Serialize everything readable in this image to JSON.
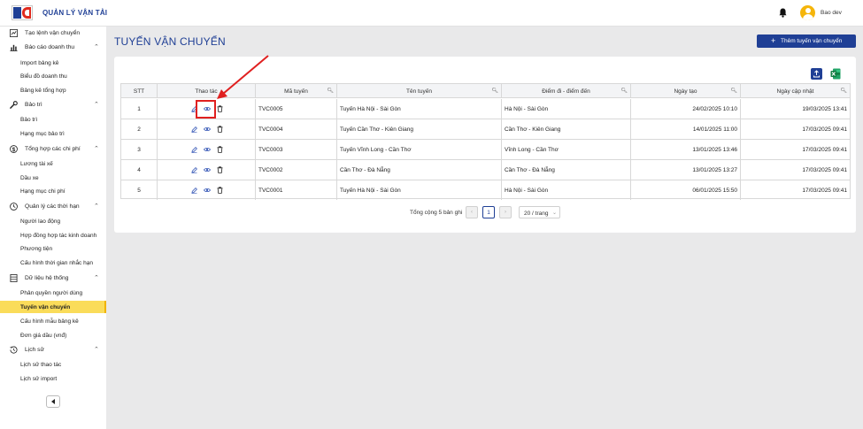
{
  "app": {
    "title": "QUẢN LÝ VẬN TẢI",
    "user": "Bao dev"
  },
  "sidebar": {
    "top_item": "Tạo lệnh vận chuyển",
    "groups": [
      {
        "label": "Báo cáo doanh thu",
        "items": [
          "Import bảng kê",
          "Biểu đồ doanh thu",
          "Bảng kê tổng hợp"
        ]
      },
      {
        "label": "Bảo trì",
        "items": [
          "Bảo trì",
          "Hạng mục bảo trì"
        ]
      },
      {
        "label": "Tổng hợp các chi phí",
        "items": [
          "Lương tài xế",
          "Dầu xe",
          "Hạng mục chi phí"
        ]
      },
      {
        "label": "Quản lý các thời hạn",
        "items": [
          "Người lao động",
          "Hợp đồng hợp tác kinh doanh",
          "Phương tiện",
          "Cấu hình thời gian nhắc hạn"
        ]
      },
      {
        "label": "Dữ liệu hệ thống",
        "items": [
          "Phân quyền người dùng",
          "Tuyến vận chuyển",
          "Cấu hình mẫu bảng kê",
          "Đơn giá dầu (vnđ)"
        ]
      },
      {
        "label": "Lịch sử",
        "items": [
          "Lịch sử thao tác",
          "Lịch sử import"
        ]
      }
    ],
    "active_item": "Tuyến vận chuyển"
  },
  "page": {
    "title": "TUYẾN VẬN CHUYỂN",
    "add_button": "Thêm tuyến vận chuyển"
  },
  "table": {
    "headers": [
      "STT",
      "Thao tác",
      "Mã tuyến",
      "Tên tuyến",
      "Điểm đi - điểm đến",
      "Ngày tạo",
      "Ngày cập nhật"
    ],
    "rows": [
      {
        "stt": "1",
        "code": "TVC0005",
        "name": "Tuyến Hà Nội - Sài Gòn",
        "route": "Hà Nội - Sài Gòn",
        "created": "24/02/2025 10:10",
        "updated": "19/03/2025 13:41"
      },
      {
        "stt": "2",
        "code": "TVC0004",
        "name": "Tuyến Cần Thơ - Kiên Giang",
        "route": "Cần Thơ - Kiên Giang",
        "created": "14/01/2025 11:00",
        "updated": "17/03/2025 09:41"
      },
      {
        "stt": "3",
        "code": "TVC0003",
        "name": "Tuyến Vĩnh Long - Cần Thơ",
        "route": "Vĩnh Long - Cần Thơ",
        "created": "13/01/2025 13:46",
        "updated": "17/03/2025 09:41"
      },
      {
        "stt": "4",
        "code": "TVC0002",
        "name": "Cần Thơ - Đà Nẵng",
        "route": "Cần Thơ - Đà Nẵng",
        "created": "13/01/2025 13:27",
        "updated": "17/03/2025 09:41"
      },
      {
        "stt": "5",
        "code": "TVC0001",
        "name": "Tuyến Hà Nội - Sài Gòn",
        "route": "Hà Nội - Sài Gòn",
        "created": "06/01/2025 15:50",
        "updated": "17/03/2025 09:41"
      }
    ]
  },
  "pagination": {
    "total": "Tổng cộng 5 bản ghi",
    "current_page": "1",
    "page_size": "20 / trang"
  },
  "colors": {
    "primary": "#1f3f95",
    "active_bg": "#fadc5a",
    "annotation": "#e02020"
  }
}
